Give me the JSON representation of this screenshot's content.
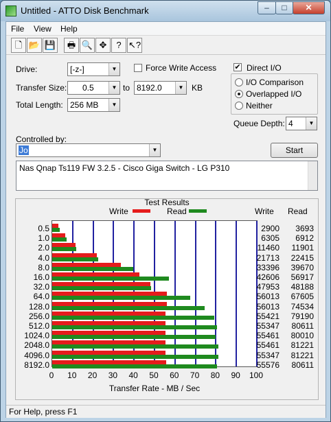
{
  "window": {
    "title": "Untitled - ATTO Disk Benchmark",
    "minimize": "–",
    "maximize": "□",
    "close": "✕"
  },
  "menu": [
    "File",
    "View",
    "Help"
  ],
  "toolbar": {
    "buttons": [
      {
        "name": "new-icon",
        "glyph": "🗋"
      },
      {
        "name": "open-icon",
        "glyph": "📂"
      },
      {
        "name": "save-icon",
        "glyph": "💾"
      },
      {
        "name": "print-icon",
        "glyph": "🖶"
      },
      {
        "name": "print-preview-icon",
        "glyph": "🔍"
      },
      {
        "name": "move-icon",
        "glyph": "✥"
      },
      {
        "name": "help-icon",
        "glyph": "?"
      },
      {
        "name": "context-help-icon",
        "glyph": "↖?"
      }
    ]
  },
  "form": {
    "drive_label": "Drive:",
    "drive_value": "[-z-]",
    "force_write_label": "Force Write Access",
    "force_write_checked": false,
    "direct_io_label": "Direct I/O",
    "direct_io_checked": true,
    "transfer_size_label": "Transfer Size:",
    "transfer_from": "0.5",
    "to_label": "to",
    "transfer_to": "8192.0",
    "kb_label": "KB",
    "total_length_label": "Total Length:",
    "total_length_value": "256 MB",
    "io_options": [
      "I/O Comparison",
      "Overlapped I/O",
      "Neither"
    ],
    "io_selected": "Overlapped I/O",
    "queue_depth_label": "Queue Depth:",
    "queue_depth_value": "4",
    "controlled_by_label": "Controlled by:",
    "controlled_by_value": "Jo",
    "start_label": "Start",
    "description": "Nas Qnap Ts119 FW 3.2.5 - Cisco Giga Switch - LG P310"
  },
  "results": {
    "title": "Test Results",
    "legend_write": "Write",
    "legend_read": "Read",
    "col_write": "Write",
    "col_read": "Read",
    "xlabel": "Transfer Rate - MB / Sec",
    "colors": {
      "write": "#e51c1c",
      "read": "#1f8a1f",
      "grid": "#2020a0"
    }
  },
  "chart_data": {
    "type": "bar",
    "orientation": "horizontal",
    "title": "Test Results",
    "xlabel": "Transfer Rate - MB / Sec",
    "xlim": [
      0,
      100
    ],
    "xticks": [
      0,
      10,
      20,
      30,
      40,
      50,
      60,
      70,
      80,
      90,
      100
    ],
    "categories": [
      "0.5",
      "1.0",
      "2.0",
      "4.0",
      "8.0",
      "16.0",
      "32.0",
      "64.0",
      "128.0",
      "256.0",
      "512.0",
      "1024.0",
      "2048.0",
      "4096.0",
      "8192.0"
    ],
    "series": [
      {
        "name": "Write",
        "values": [
          2900,
          6305,
          11460,
          21713,
          33396,
          42606,
          47953,
          56013,
          56013,
          55421,
          55347,
          55461,
          55461,
          55347,
          55576
        ]
      },
      {
        "name": "Read",
        "values": [
          3693,
          6912,
          11901,
          22415,
          39670,
          56917,
          48188,
          67605,
          74534,
          79190,
          80611,
          80010,
          81221,
          81221,
          80611
        ]
      }
    ],
    "value_units": "KB/s",
    "legend": "top"
  },
  "status": {
    "text": "For Help, press F1"
  }
}
